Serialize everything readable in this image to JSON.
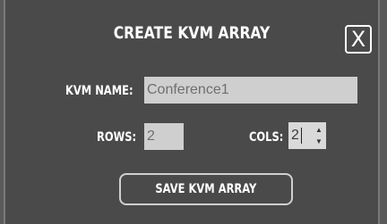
{
  "dialog": {
    "title": "CREATE KVM ARRAY",
    "close_label": "X"
  },
  "form": {
    "kvm_name_label": "KVM NAME:",
    "kvm_name_value": "Conference1",
    "rows_label": "ROWS:",
    "rows_value": "2",
    "cols_label": "COLS:",
    "cols_value": "2"
  },
  "actions": {
    "save_label": "SAVE KVM ARRAY"
  },
  "icons": {
    "spinner_up": "▲",
    "spinner_down": "▼"
  }
}
